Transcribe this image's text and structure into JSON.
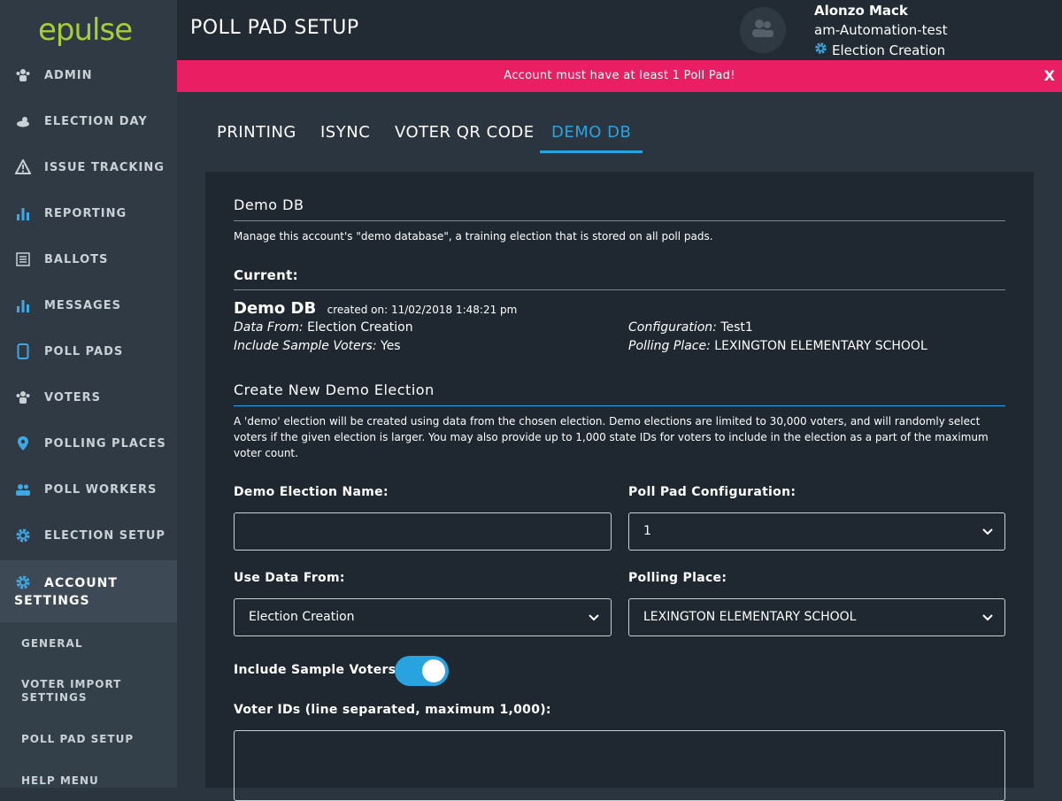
{
  "app": {
    "logo": "epulse"
  },
  "sidebar": {
    "items": [
      {
        "label": "ADMIN",
        "icon": "people-icon"
      },
      {
        "label": "ELECTION DAY",
        "icon": "weather-icon"
      },
      {
        "label": "ISSUE TRACKING",
        "icon": "warning-icon"
      },
      {
        "label": "REPORTING",
        "icon": "bar-chart-icon"
      },
      {
        "label": "BALLOTS",
        "icon": "ballot-icon"
      },
      {
        "label": "MESSAGES",
        "icon": "bar-chart-icon"
      },
      {
        "label": "POLL PADS",
        "icon": "tablet-icon"
      },
      {
        "label": "VOTERS",
        "icon": "people-icon"
      },
      {
        "label": "POLLING PLACES",
        "icon": "map-pin-icon"
      },
      {
        "label": "POLL WORKERS",
        "icon": "group-icon"
      },
      {
        "label": "ELECTION SETUP",
        "icon": "gear-icon"
      }
    ],
    "active": {
      "label_line1": "ACCOUNT",
      "label_line2": "SETTINGS",
      "icon": "gear-icon"
    },
    "subitems": [
      {
        "label": "GENERAL"
      },
      {
        "label_line1": "VOTER IMPORT",
        "label_line2": "SETTINGS"
      },
      {
        "label": "POLL PAD SETUP"
      },
      {
        "label": "HELP MENU"
      }
    ]
  },
  "header": {
    "title": "POLL PAD SETUP",
    "user_name": "Alonzo Mack",
    "account": "am-Automation-test",
    "election": "Election Creation"
  },
  "alert": {
    "message": "Account must have at least 1 Poll Pad!",
    "close": "X"
  },
  "tabs": [
    {
      "label": "PRINTING"
    },
    {
      "label": "ISYNC"
    },
    {
      "label": "VOTER QR CODE"
    },
    {
      "label": "DEMO DB",
      "active": true
    }
  ],
  "demo_db": {
    "title": "Demo DB",
    "description": "Manage this account's \"demo database\", a training election that is stored on all poll pads.",
    "current_heading": "Current:",
    "current": {
      "name": "Demo DB",
      "created_label": "created on: 11/02/2018 1:48:21 pm",
      "data_from_label": "Data From:",
      "data_from_value": "Election Creation",
      "sample_voters_label": "Include Sample Voters:",
      "sample_voters_value": "Yes",
      "configuration_label": "Configuration:",
      "configuration_value": "Test1",
      "polling_place_label": "Polling Place:",
      "polling_place_value": "LEXINGTON ELEMENTARY SCHOOL"
    },
    "create_heading": "Create New Demo Election",
    "create_description": "A 'demo' election will be created using data from the chosen election. Demo elections are limited to 30,000 voters, and will randomly select voters if the given election is larger. You may also provide up to 1,000 state IDs for voters to include in the election as a part of the maximum voter count.",
    "form": {
      "name_label": "Demo Election Name:",
      "name_value": "",
      "config_label": "Poll Pad Configuration:",
      "config_value": "1",
      "use_data_label": "Use Data From:",
      "use_data_value": "Election Creation",
      "polling_place_label": "Polling Place:",
      "polling_place_value": "LEXINGTON ELEMENTARY SCHOOL",
      "sample_voters_label": "Include Sample Voters",
      "sample_voters_on": true,
      "voter_ids_label": "Voter IDs (line separated, maximum 1,000):",
      "voter_ids_value": ""
    }
  },
  "colors": {
    "accent": "#29a3e0",
    "alert": "#e91e63",
    "logo": "#a6ce39"
  }
}
